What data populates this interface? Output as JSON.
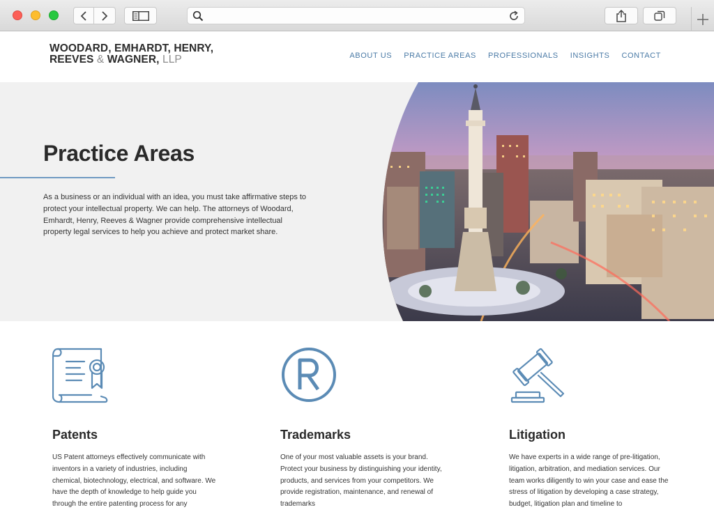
{
  "browser": {
    "address_value": "",
    "icons": [
      "back-icon",
      "forward-icon",
      "sidebar-icon",
      "search-icon",
      "reload-icon",
      "share-icon",
      "tabs-icon",
      "plus-icon"
    ]
  },
  "site": {
    "logo": {
      "line1": "WOODARD, EMHARDT, HENRY,",
      "line2_a": "REEVES",
      "amp": "&",
      "line2_b": "WAGNER,",
      "llp": "LLP"
    },
    "nav": [
      "ABOUT US",
      "PRACTICE AREAS",
      "PROFESSIONALS",
      "INSIGHTS",
      "CONTACT"
    ],
    "accent_color": "#4a7aa6"
  },
  "hero": {
    "title": "Practice Areas",
    "text": "As a business or an individual with an idea, you must take affirmative steps to protect your intellectual property. We can help. The attorneys of Woodard, Emhardt, Henry, Reeves & Wagner provide comprehensive intellectual property legal services to help you achieve and protect market share."
  },
  "cards": [
    {
      "title": "Patents",
      "icon": "certificate-scroll-icon",
      "text": "US Patent attorneys effectively communicate with inventors in a variety of industries, including chemical, biotechnology, electrical, and software. We have the depth of knowledge to help guide you through the entire patenting process for any"
    },
    {
      "title": "Trademarks",
      "icon": "registered-trademark-icon",
      "text": "One of your most valuable assets is your brand. Protect your business by distinguishing your identity, products, and services from your competitors. We provide registration, maintenance, and renewal of trademarks"
    },
    {
      "title": "Litigation",
      "icon": "gavel-icon",
      "text": "We have experts in a wide range of pre-litigation, litigation, arbitration, and mediation services. Our team works diligently to win your case and ease the stress of litigation by developing a case strategy, budget, litigation plan and timeline to"
    }
  ]
}
